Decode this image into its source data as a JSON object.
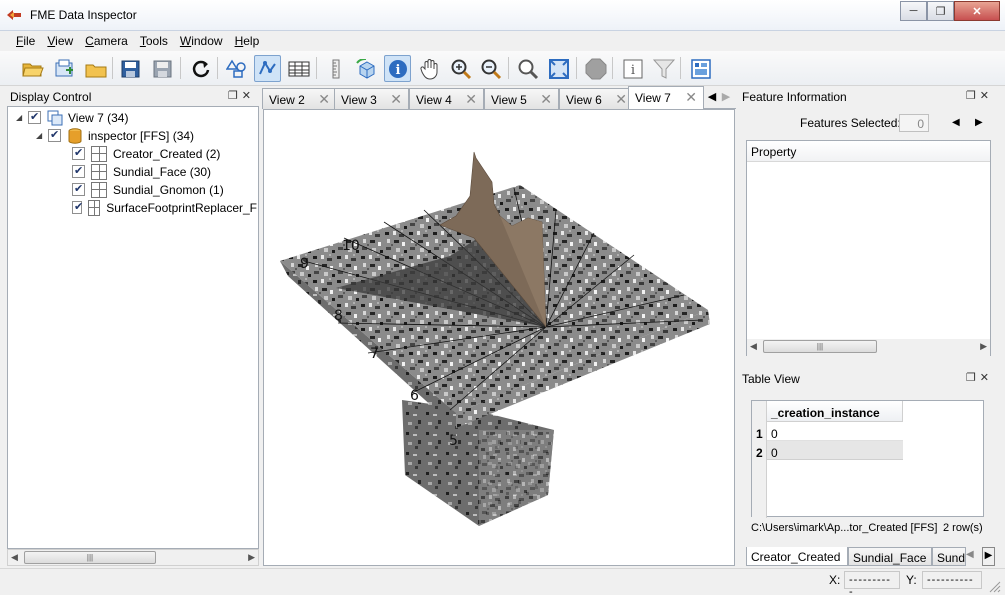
{
  "window": {
    "title": "FME Data Inspector",
    "minimize_glyph": "─",
    "restore_glyph": "❐",
    "close_glyph": "✕"
  },
  "menu": [
    {
      "accel": "F",
      "rest": "ile"
    },
    {
      "accel": "V",
      "rest": "iew"
    },
    {
      "accel": "C",
      "rest": "amera"
    },
    {
      "accel": "T",
      "rest": "ools"
    },
    {
      "accel": "W",
      "rest": "indow"
    },
    {
      "accel": "H",
      "rest": "elp"
    }
  ],
  "toolbar_icons": [
    "open-folder-icon",
    "open-dataset-icon",
    "add-dataset-icon",
    "save-icon",
    "save-as-icon",
    "refresh-icon",
    "shapes-icon",
    "select-3d-icon",
    "table-icon",
    "measure-icon",
    "cube-rotate-icon",
    "info-icon",
    "pan-hand-icon",
    "zoom-in-icon",
    "zoom-out-icon",
    "zoom-selection-icon",
    "zoom-extents-icon",
    "stop-icon",
    "feature-info-icon",
    "filter-icon",
    "layout-icon"
  ],
  "display_control": {
    "title": "Display Control",
    "tree": {
      "view": "View 7 (34)",
      "dataset": "inspector [FFS] (34)",
      "features": [
        "Creator_Created (2)",
        "Sundial_Face (30)",
        "Sundial_Gnomon (1)",
        "SurfaceFootprintReplacer_F"
      ]
    }
  },
  "tabs": [
    {
      "label": "View 2",
      "close": "✕"
    },
    {
      "label": "View 3",
      "close": "✕"
    },
    {
      "label": "View 4",
      "close": "✕"
    },
    {
      "label": "View 5",
      "close": "✕"
    },
    {
      "label": "View 6",
      "close": "✕"
    },
    {
      "label": "View 7",
      "close": "✕"
    }
  ],
  "sundial_numerals": [
    "8",
    "7",
    "6",
    "5",
    "10",
    "9"
  ],
  "feature_information": {
    "title": "Feature Information",
    "features_selected_label": "Features Selected:",
    "features_selected_value": "0",
    "column_header": "Property"
  },
  "table_view": {
    "title": "Table View",
    "column": "_creation_instance",
    "rows": [
      {
        "num": "1",
        "value": "0"
      },
      {
        "num": "2",
        "value": "0"
      }
    ],
    "path": "C:\\Users\\imark\\Ap...tor_Created [FFS]",
    "row_count": "2 row(s)",
    "bottom_tabs": [
      "Creator_Created",
      "Sundial_Face",
      "Sund"
    ]
  },
  "status": {
    "x_label": "X:",
    "x_value": "----------",
    "y_label": "Y:",
    "y_value": "----------"
  },
  "colors": {
    "accent": "#3b6fb6",
    "stone": "#8a8a8a",
    "gnomon": "#7d6a58"
  }
}
